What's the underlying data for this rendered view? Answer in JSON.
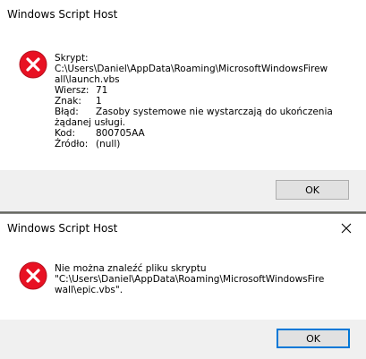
{
  "dialog1": {
    "title": "Windows Script Host",
    "heading": "Skrypt:",
    "path": "C:\\Users\\Daniel\\AppData\\Roaming\\MicrosoftWindowsFirewall\\launch.vbs",
    "fields": [
      {
        "label": "Wiersz:",
        "value": "71"
      },
      {
        "label": "Znak:",
        "value": "1"
      },
      {
        "label": "Błąd:",
        "value": "Zasoby systemowe nie wystarczają do ukończenia żądanej usługi."
      },
      {
        "label": "Kod:",
        "value": "800705AA"
      },
      {
        "label": "Źródło:",
        "value": "(null)"
      }
    ],
    "ok_label": "OK"
  },
  "dialog2": {
    "title": "Windows Script Host",
    "message_line1": "Nie można znaleźć pliku skryptu",
    "message_line2": "\"C:\\Users\\Daniel\\AppData\\Roaming\\MicrosoftWindowsFirewall\\epic.vbs\".",
    "ok_label": "OK"
  },
  "icons": {
    "error": "error-icon",
    "close": "close-icon"
  },
  "colors": {
    "error_red": "#e81123",
    "focus_blue": "#0078d7",
    "footer_gray": "#f0f0f0"
  }
}
